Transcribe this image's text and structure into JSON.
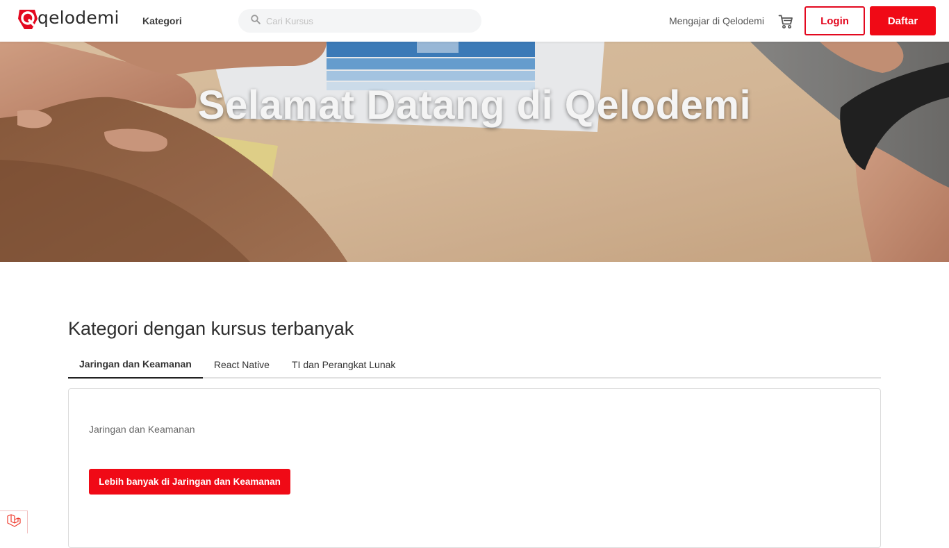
{
  "header": {
    "logo_text": "qelodemi",
    "logo_letter": "Q",
    "kategori_label": "Kategori",
    "search_placeholder": "Cari Kursus",
    "teach_label": "Mengajar di Qelodemi",
    "login_label": "Login",
    "register_label": "Daftar"
  },
  "hero": {
    "title": "Selamat Datang di Qelodemi"
  },
  "section": {
    "title": "Kategori dengan kursus terbanyak",
    "tabs": [
      {
        "label": "Jaringan dan Keamanan",
        "active": true
      },
      {
        "label": "React Native",
        "active": false
      },
      {
        "label": "TI dan Perangkat Lunak",
        "active": false
      }
    ],
    "card": {
      "label": "Jaringan dan Keamanan",
      "button_label": "Lebih banyak di Jaringan dan Keamanan"
    }
  },
  "colors": {
    "brand_red": "#f00a16",
    "text_dark": "#2e2e2e"
  },
  "icons": {
    "search": "search-icon",
    "cart": "cart-icon",
    "laravel": "laravel-icon"
  }
}
